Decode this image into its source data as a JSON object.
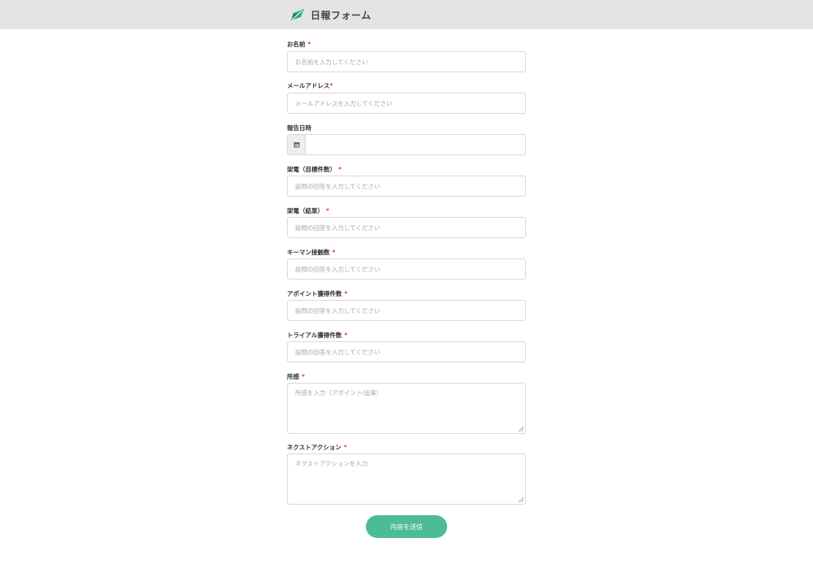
{
  "header": {
    "title": "日報フォーム",
    "logo_icon": "leaf-logo-icon",
    "colors": {
      "header_bg": "#e4e4e4",
      "logo_green": "#2bb07a"
    }
  },
  "form": {
    "required_mark": "*",
    "fields": [
      {
        "label": "お名前",
        "required": true,
        "type": "text",
        "placeholder": "お名前を入力してください"
      },
      {
        "label": "メールアドレス",
        "required": true,
        "type": "text",
        "placeholder": "メールアドレスを入力してください"
      },
      {
        "label": "報告日時",
        "required": false,
        "type": "date",
        "placeholder": "",
        "icon": "calendar-icon"
      },
      {
        "label": "架電（目標件数）",
        "required": true,
        "type": "text",
        "placeholder": "設問の回答を入力してください"
      },
      {
        "label": "架電（結果）",
        "required": true,
        "type": "text",
        "placeholder": "設問の回答を入力してください"
      },
      {
        "label": "キーマン接触数",
        "required": true,
        "type": "text",
        "placeholder": "設問の回答を入力してください"
      },
      {
        "label": "アポイント獲得件数",
        "required": true,
        "type": "text",
        "placeholder": "設問の回答を入力してください"
      },
      {
        "label": "トライアル獲得件数",
        "required": true,
        "type": "text",
        "placeholder": "設問の回答を入力してください"
      },
      {
        "label": "所感",
        "required": true,
        "type": "textarea",
        "placeholder": "所感を入力（アポイント/追客）"
      },
      {
        "label": "ネクストアクション",
        "required": true,
        "type": "textarea",
        "placeholder": "ネクストアクションを入力"
      }
    ],
    "submit_label": "内容を送信",
    "colors": {
      "submit_bg": "#4cbb97",
      "required": "#e3453c"
    }
  }
}
